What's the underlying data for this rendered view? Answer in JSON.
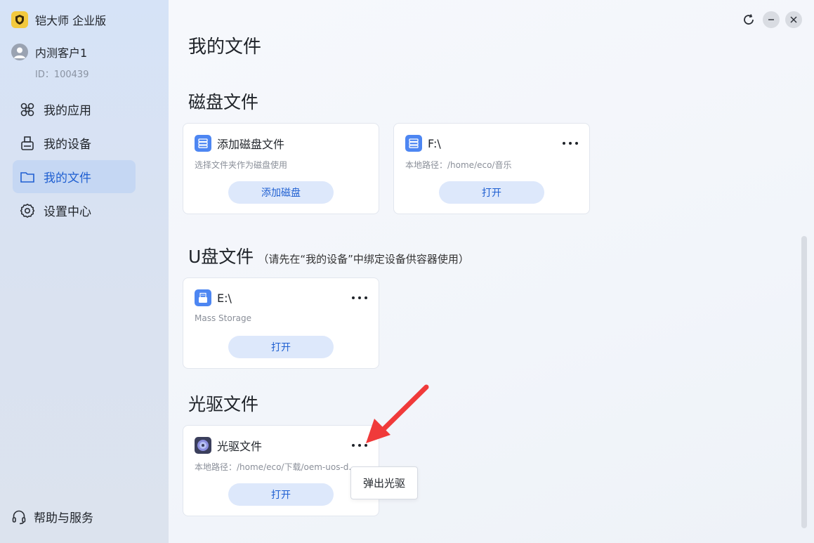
{
  "app": {
    "title": "铠大师 企业版"
  },
  "user": {
    "name": "内测客户1",
    "id_label": "ID：100439"
  },
  "nav": [
    {
      "label": "我的应用",
      "icon": "apps-icon",
      "active": false
    },
    {
      "label": "我的设备",
      "icon": "device-icon",
      "active": false
    },
    {
      "label": "我的文件",
      "icon": "folder-icon",
      "active": true
    },
    {
      "label": "设置中心",
      "icon": "gear-icon",
      "active": false
    }
  ],
  "help": {
    "label": "帮助与服务"
  },
  "main": {
    "page_title": "我的文件",
    "disk_section": {
      "title": "磁盘文件",
      "cards": [
        {
          "title": "添加磁盘文件",
          "subtitle": "选择文件夹作为磁盘使用",
          "button": "添加磁盘"
        },
        {
          "title": "F:\\",
          "subtitle": "本地路径：/home/eco/音乐",
          "button": "打开"
        }
      ]
    },
    "usb_section": {
      "title": "U盘文件",
      "note": "（请先在“我的设备”中绑定设备供容器使用）",
      "cards": [
        {
          "title": "E:\\",
          "subtitle": "Mass Storage",
          "button": "打开"
        }
      ]
    },
    "optical_section": {
      "title": "光驱文件",
      "cards": [
        {
          "title": "光驱文件",
          "subtitle": "本地路径：/home/eco/下载/oem-uos-d...",
          "button": "打开"
        }
      ]
    },
    "context_menu": {
      "item": "弹出光驱"
    }
  },
  "colors": {
    "accent": "#1f5fd1",
    "nav_active_bg": "#c5d7f3",
    "button_bg": "#dde8fb",
    "annotation_arrow": "#f03a3a"
  }
}
